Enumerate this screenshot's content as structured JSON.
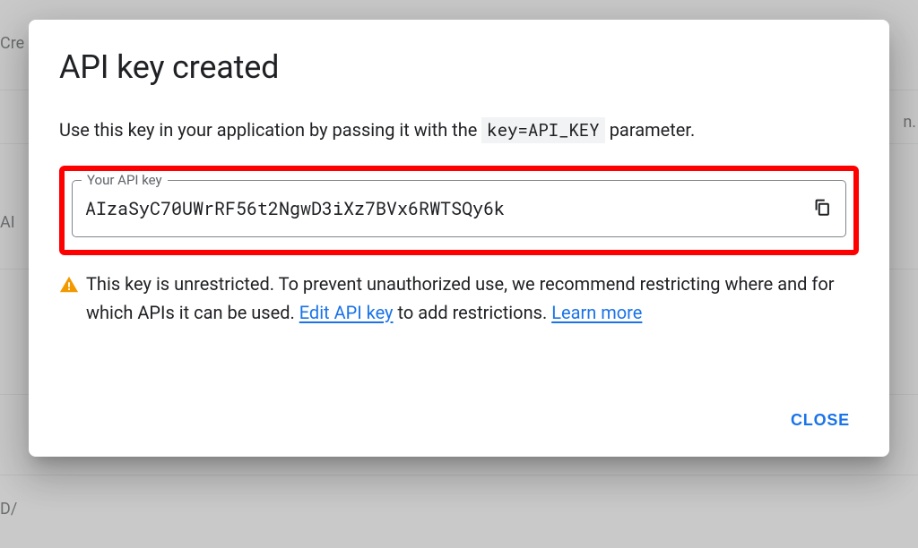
{
  "backdrop": {
    "topLeft": "Cre",
    "right": "n.",
    "apiLabel": "AI",
    "daLabel": "D/"
  },
  "modal": {
    "title": "API key created",
    "descriptionPrefix": "Use this key in your application by passing it with the ",
    "codeParam": "key=API_KEY",
    "descriptionSuffix": " parameter.",
    "keyField": {
      "label": "Your API key",
      "value": "AIzaSyC70UWrRF56t2NgwD3iXz7BVx6RWTSQy6k"
    },
    "warning": {
      "textBeforeEdit": "This key is unrestricted. To prevent unauthorized use, we recommend restricting where and for which APIs it can be used. ",
      "editLinkLabel": "Edit API key",
      "textMiddle": " to add restrictions. ",
      "learnMoreLabel": "Learn more"
    },
    "closeLabel": "CLOSE"
  }
}
